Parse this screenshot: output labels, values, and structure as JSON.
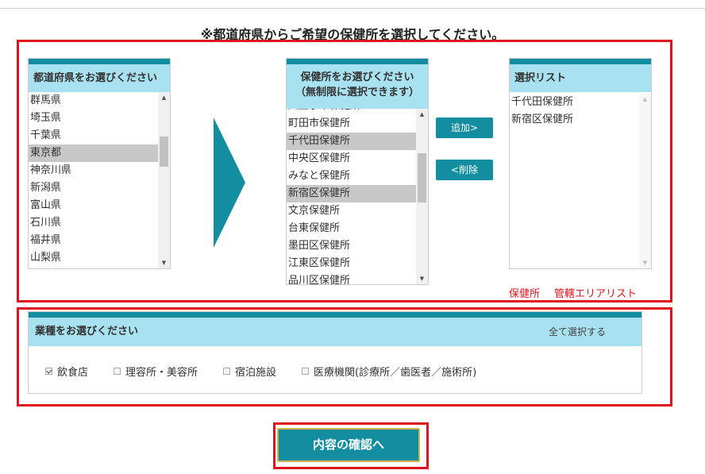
{
  "page": {
    "title": "※都道府県からご希望の保健所を選択してください。"
  },
  "prefecture_panel": {
    "header": "都道府県をお選びください",
    "items": [
      {
        "label": "群馬県",
        "selected": false
      },
      {
        "label": "埼玉県",
        "selected": false
      },
      {
        "label": "千葉県",
        "selected": false
      },
      {
        "label": "東京都",
        "selected": true
      },
      {
        "label": "神奈川県",
        "selected": false
      },
      {
        "label": "新潟県",
        "selected": false
      },
      {
        "label": "富山県",
        "selected": false
      },
      {
        "label": "石川県",
        "selected": false
      },
      {
        "label": "福井県",
        "selected": false
      },
      {
        "label": "山梨県",
        "selected": false
      }
    ]
  },
  "office_panel": {
    "header_line1": "保健所をお選びください",
    "header_line2": "（無制限に選択できます）",
    "items": [
      {
        "label": "八王子市保健所",
        "selected": false
      },
      {
        "label": "町田市保健所",
        "selected": false
      },
      {
        "label": "千代田保健所",
        "selected": true
      },
      {
        "label": "中央区保健所",
        "selected": false
      },
      {
        "label": "みなと保健所",
        "selected": false
      },
      {
        "label": "新宿区保健所",
        "selected": true
      },
      {
        "label": "文京保健所",
        "selected": false
      },
      {
        "label": "台東保健所",
        "selected": false
      },
      {
        "label": "墨田区保健所",
        "selected": false
      },
      {
        "label": "江東区保健所",
        "selected": false
      },
      {
        "label": "品川区保健所",
        "selected": false
      }
    ]
  },
  "buttons": {
    "add": "追加>",
    "remove": "<削除"
  },
  "selected_panel": {
    "header": "選択リスト",
    "items": [
      "千代田保健所",
      "新宿区保健所"
    ]
  },
  "links": {
    "office": "保健所",
    "jurisdiction": "管轄エリアリスト"
  },
  "business_panel": {
    "header": "業種をお選びください",
    "select_all": "全て選択する",
    "options": [
      {
        "label": "飲食店",
        "checked": true
      },
      {
        "label": "理容所・美容所",
        "checked": false
      },
      {
        "label": "宿泊施設",
        "checked": false
      },
      {
        "label": "医療機関(診療所／歯医者／施術所)",
        "checked": false
      }
    ]
  },
  "confirm_button": "内容の確認へ",
  "colors": {
    "teal": "#128ea0",
    "header_bg": "#a8e1ef",
    "red": "#e0141f",
    "selected_bg": "#c8c8c8"
  }
}
